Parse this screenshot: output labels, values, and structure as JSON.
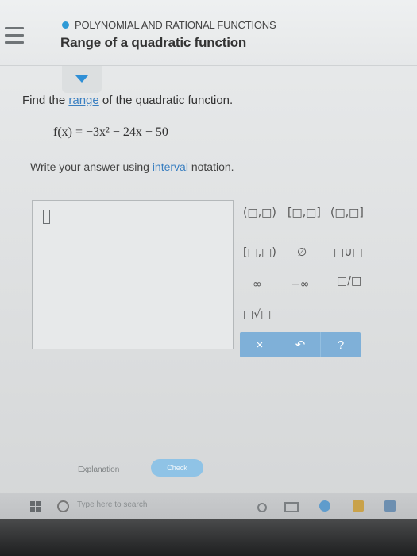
{
  "header": {
    "topic": "POLYNOMIAL AND RATIONAL FUNCTIONS",
    "title": "Range of a quadratic function"
  },
  "problem": {
    "prompt_before": "Find the ",
    "prompt_link": "range",
    "prompt_after": " of the quadratic function.",
    "equation": "f(x) = −3x² − 24x − 50",
    "instruction_before": "Write your answer using ",
    "instruction_link": "interval",
    "instruction_after": " notation."
  },
  "keypad": {
    "open_open": "(□,□)",
    "closed_closed": "[□,□]",
    "open_closed": "(□,□]",
    "closed_open": "[□,□)",
    "empty_set": "∅",
    "union": "□∪□",
    "infinity": "∞",
    "neg_infinity": "−∞",
    "fraction": "□/□",
    "sqrt": "□√□",
    "clear": "×",
    "undo": "↶",
    "help": "?"
  },
  "footer": {
    "explanation_label": "Explanation",
    "check_label": "Check"
  },
  "taskbar": {
    "search_placeholder": "Type here to search"
  },
  "colors": {
    "accent": "#2f8fd6",
    "keypad_bar": "#7fb0d8",
    "check_button": "#8fc3e6"
  }
}
